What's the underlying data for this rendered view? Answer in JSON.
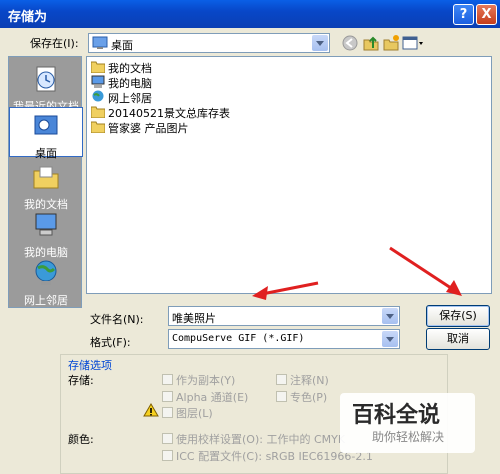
{
  "window": {
    "title": "存储为",
    "help": "?",
    "close": "X"
  },
  "save_in": {
    "label": "保存在(I):",
    "value": "桌面"
  },
  "places": [
    {
      "label": "我最近的文档",
      "icon": "recent-docs-icon"
    },
    {
      "label": "桌面",
      "icon": "desktop-icon"
    },
    {
      "label": "我的文档",
      "icon": "my-documents-icon"
    },
    {
      "label": "我的电脑",
      "icon": "my-computer-icon"
    },
    {
      "label": "网上邻居",
      "icon": "network-icon"
    }
  ],
  "files": [
    {
      "name": "我的文档",
      "icon": "my-documents-icon"
    },
    {
      "name": "我的电脑",
      "icon": "my-computer-icon"
    },
    {
      "name": "网上邻居",
      "icon": "network-icon"
    },
    {
      "name": "20140521景文总库存表",
      "icon": "folder-icon"
    },
    {
      "name": "管家婆 产品图片",
      "icon": "folder-icon"
    }
  ],
  "filename": {
    "label": "文件名(N):",
    "value": "唯美照片"
  },
  "format": {
    "label": "格式(F):",
    "value": "CompuServe GIF (*.GIF)"
  },
  "buttons": {
    "save": "保存(S)",
    "cancel": "取消"
  },
  "options": {
    "group_title": "存储选项",
    "store_label": "存储:",
    "as_copy": "作为副本(Y)",
    "notes": "注释(N)",
    "alpha": "Alpha 通道(E)",
    "spot": "专色(P)",
    "layers": "图层(L)",
    "color_label": "颜色:",
    "proof": "使用校样设置(O): 工作中的 CMYK",
    "icc": "ICC 配置文件(C): sRGB IEC61966-2.1"
  },
  "watermark": {
    "line1": "百科全说",
    "line2": "助你轻松解决"
  },
  "colors": {
    "title_bar": "#0a5fe6",
    "dialog_bg": "#ece9d8",
    "arrow": "#e02020"
  }
}
